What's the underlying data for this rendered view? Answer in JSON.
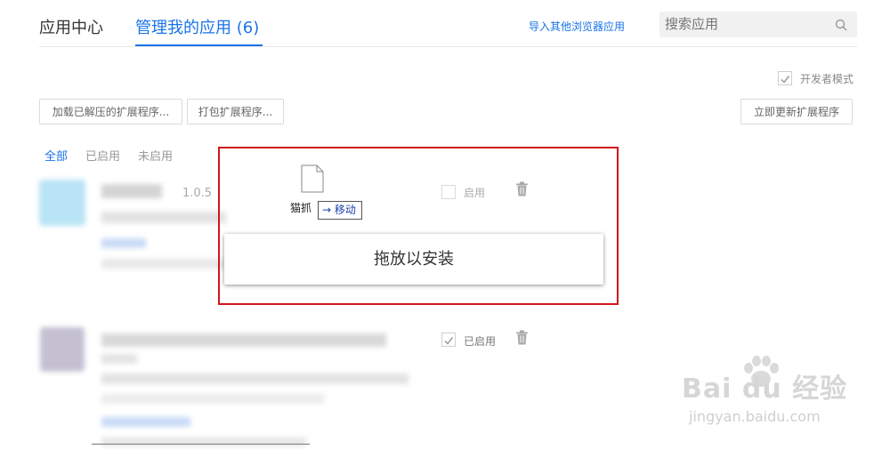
{
  "header": {
    "tab_app_center": "应用中心",
    "tab_manage": "管理我的应用 (6)",
    "import_link": "导入其他浏览器应用",
    "search_placeholder": "搜索应用"
  },
  "developer_mode": {
    "label": "开发者模式",
    "checked": true
  },
  "toolbar": {
    "load_unpacked": "加载已解压的扩展程序...",
    "pack": "打包扩展程序...",
    "update_now": "立即更新扩展程序"
  },
  "filters": {
    "all": "全部",
    "enabled": "已启用",
    "disabled": "未启用"
  },
  "extensions": [
    {
      "version": "1.0.5",
      "toggle_label": "启用",
      "enabled": false
    },
    {
      "toggle_label": "已启用",
      "enabled": true
    }
  ],
  "drag_overlay": {
    "file_name": "猫抓",
    "move_tip": "→ 移动",
    "drop_prompt": "拖放以安装"
  },
  "watermark": {
    "brand": "Bai du 经验",
    "url": "jingyan.baidu.com"
  },
  "colors": {
    "accent": "#1a73e8",
    "highlight_border": "#d0151b"
  },
  "icons": [
    "search-icon",
    "trash-icon",
    "file-icon",
    "checkbox-checked-icon",
    "paw-icon"
  ]
}
